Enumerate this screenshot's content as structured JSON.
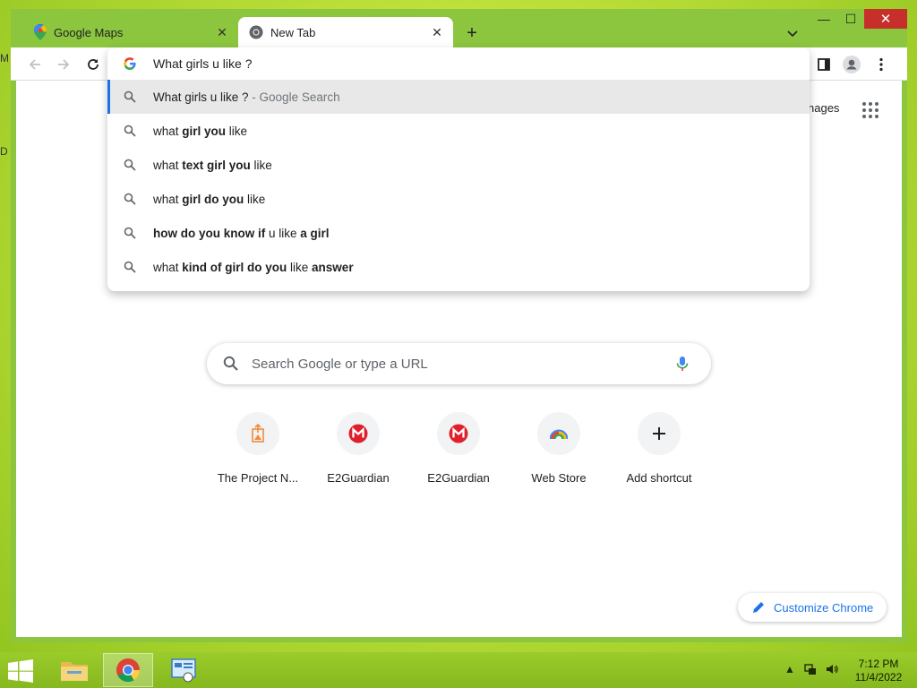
{
  "tabs": [
    {
      "title": "Google Maps",
      "icon": "google-maps-icon",
      "active": false
    },
    {
      "title": "New Tab",
      "icon": "chrome-icon",
      "active": true
    }
  ],
  "window_controls": {
    "minimize": "—",
    "maximize": "☐",
    "close": "✕"
  },
  "omnibox": {
    "query": "What girls u like ?",
    "suggestions": [
      {
        "parts": [
          {
            "t": "What girls u like ?",
            "b": false
          },
          {
            "t": " - Google Search",
            "dim": true
          }
        ],
        "selected": true
      },
      {
        "parts": [
          {
            "t": "what ",
            "b": false
          },
          {
            "t": "girl you",
            "b": true
          },
          {
            "t": " like",
            "b": false
          }
        ]
      },
      {
        "parts": [
          {
            "t": "what ",
            "b": false
          },
          {
            "t": "text girl you",
            "b": true
          },
          {
            "t": " like",
            "b": false
          }
        ]
      },
      {
        "parts": [
          {
            "t": "what ",
            "b": false
          },
          {
            "t": "girl do you",
            "b": true
          },
          {
            "t": " like",
            "b": false
          }
        ]
      },
      {
        "parts": [
          {
            "t": "how do you know if",
            "b": true
          },
          {
            "t": " u like ",
            "b": false
          },
          {
            "t": "a girl",
            "b": true
          }
        ]
      },
      {
        "parts": [
          {
            "t": "what ",
            "b": false
          },
          {
            "t": "kind of girl do you",
            "b": true
          },
          {
            "t": " like ",
            "b": false
          },
          {
            "t": "answer",
            "b": true
          }
        ]
      }
    ]
  },
  "ntp": {
    "images_link": "nages",
    "search_placeholder": "Search Google or type a URL",
    "shortcuts": [
      {
        "label": "The Project N...",
        "icon": "project-icon"
      },
      {
        "label": "E2Guardian",
        "icon": "e2guardian-icon"
      },
      {
        "label": "E2Guardian",
        "icon": "e2guardian-icon"
      },
      {
        "label": "Web Store",
        "icon": "web-store-icon"
      },
      {
        "label": "Add shortcut",
        "icon": "plus-icon"
      }
    ],
    "customize_label": "Customize Chrome"
  },
  "taskbar": {
    "apps": [
      "file-explorer-icon",
      "chrome-icon",
      "control-panel-icon"
    ],
    "time": "7:12 PM",
    "date": "11/4/2022"
  },
  "desktop": {
    "glyph_top": "M",
    "glyph_mid": "D"
  },
  "colors": {
    "accent": "#1a73e8",
    "close_red": "#c7302a",
    "frame_green": "#8cc63f"
  }
}
